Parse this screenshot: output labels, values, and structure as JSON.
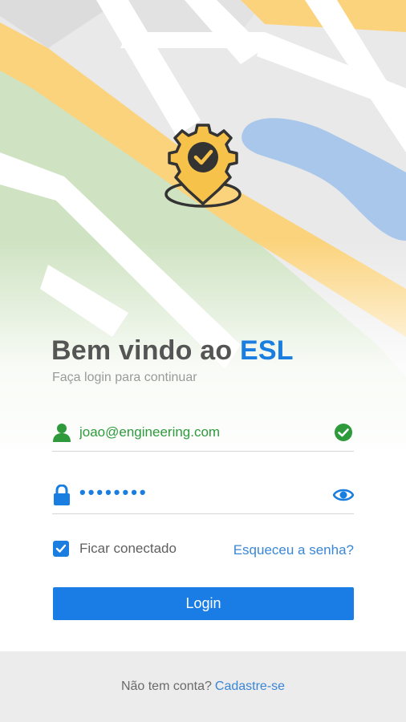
{
  "header": {
    "title_prefix": "Bem vindo ao ",
    "title_brand": "ESL",
    "subtitle": "Faça login para continuar"
  },
  "email_field": {
    "value": "joao@engineering.com",
    "lead_icon": "person-icon",
    "status_icon": "check-circle-icon"
  },
  "password_field": {
    "value": "••••••••",
    "lead_icon": "lock-icon",
    "toggle_icon": "eye-icon"
  },
  "remember": {
    "label": "Ficar conectado",
    "checked": true
  },
  "forgot_link": "Esqueceu a senha?",
  "login_button": "Login",
  "footer": {
    "question": "Não tem conta?",
    "signup_link": "Cadastre-se"
  },
  "colors": {
    "brand": "#1a7de0",
    "success": "#2e9a3c",
    "logo_yellow": "#f7c24a",
    "logo_dark": "#333333"
  }
}
